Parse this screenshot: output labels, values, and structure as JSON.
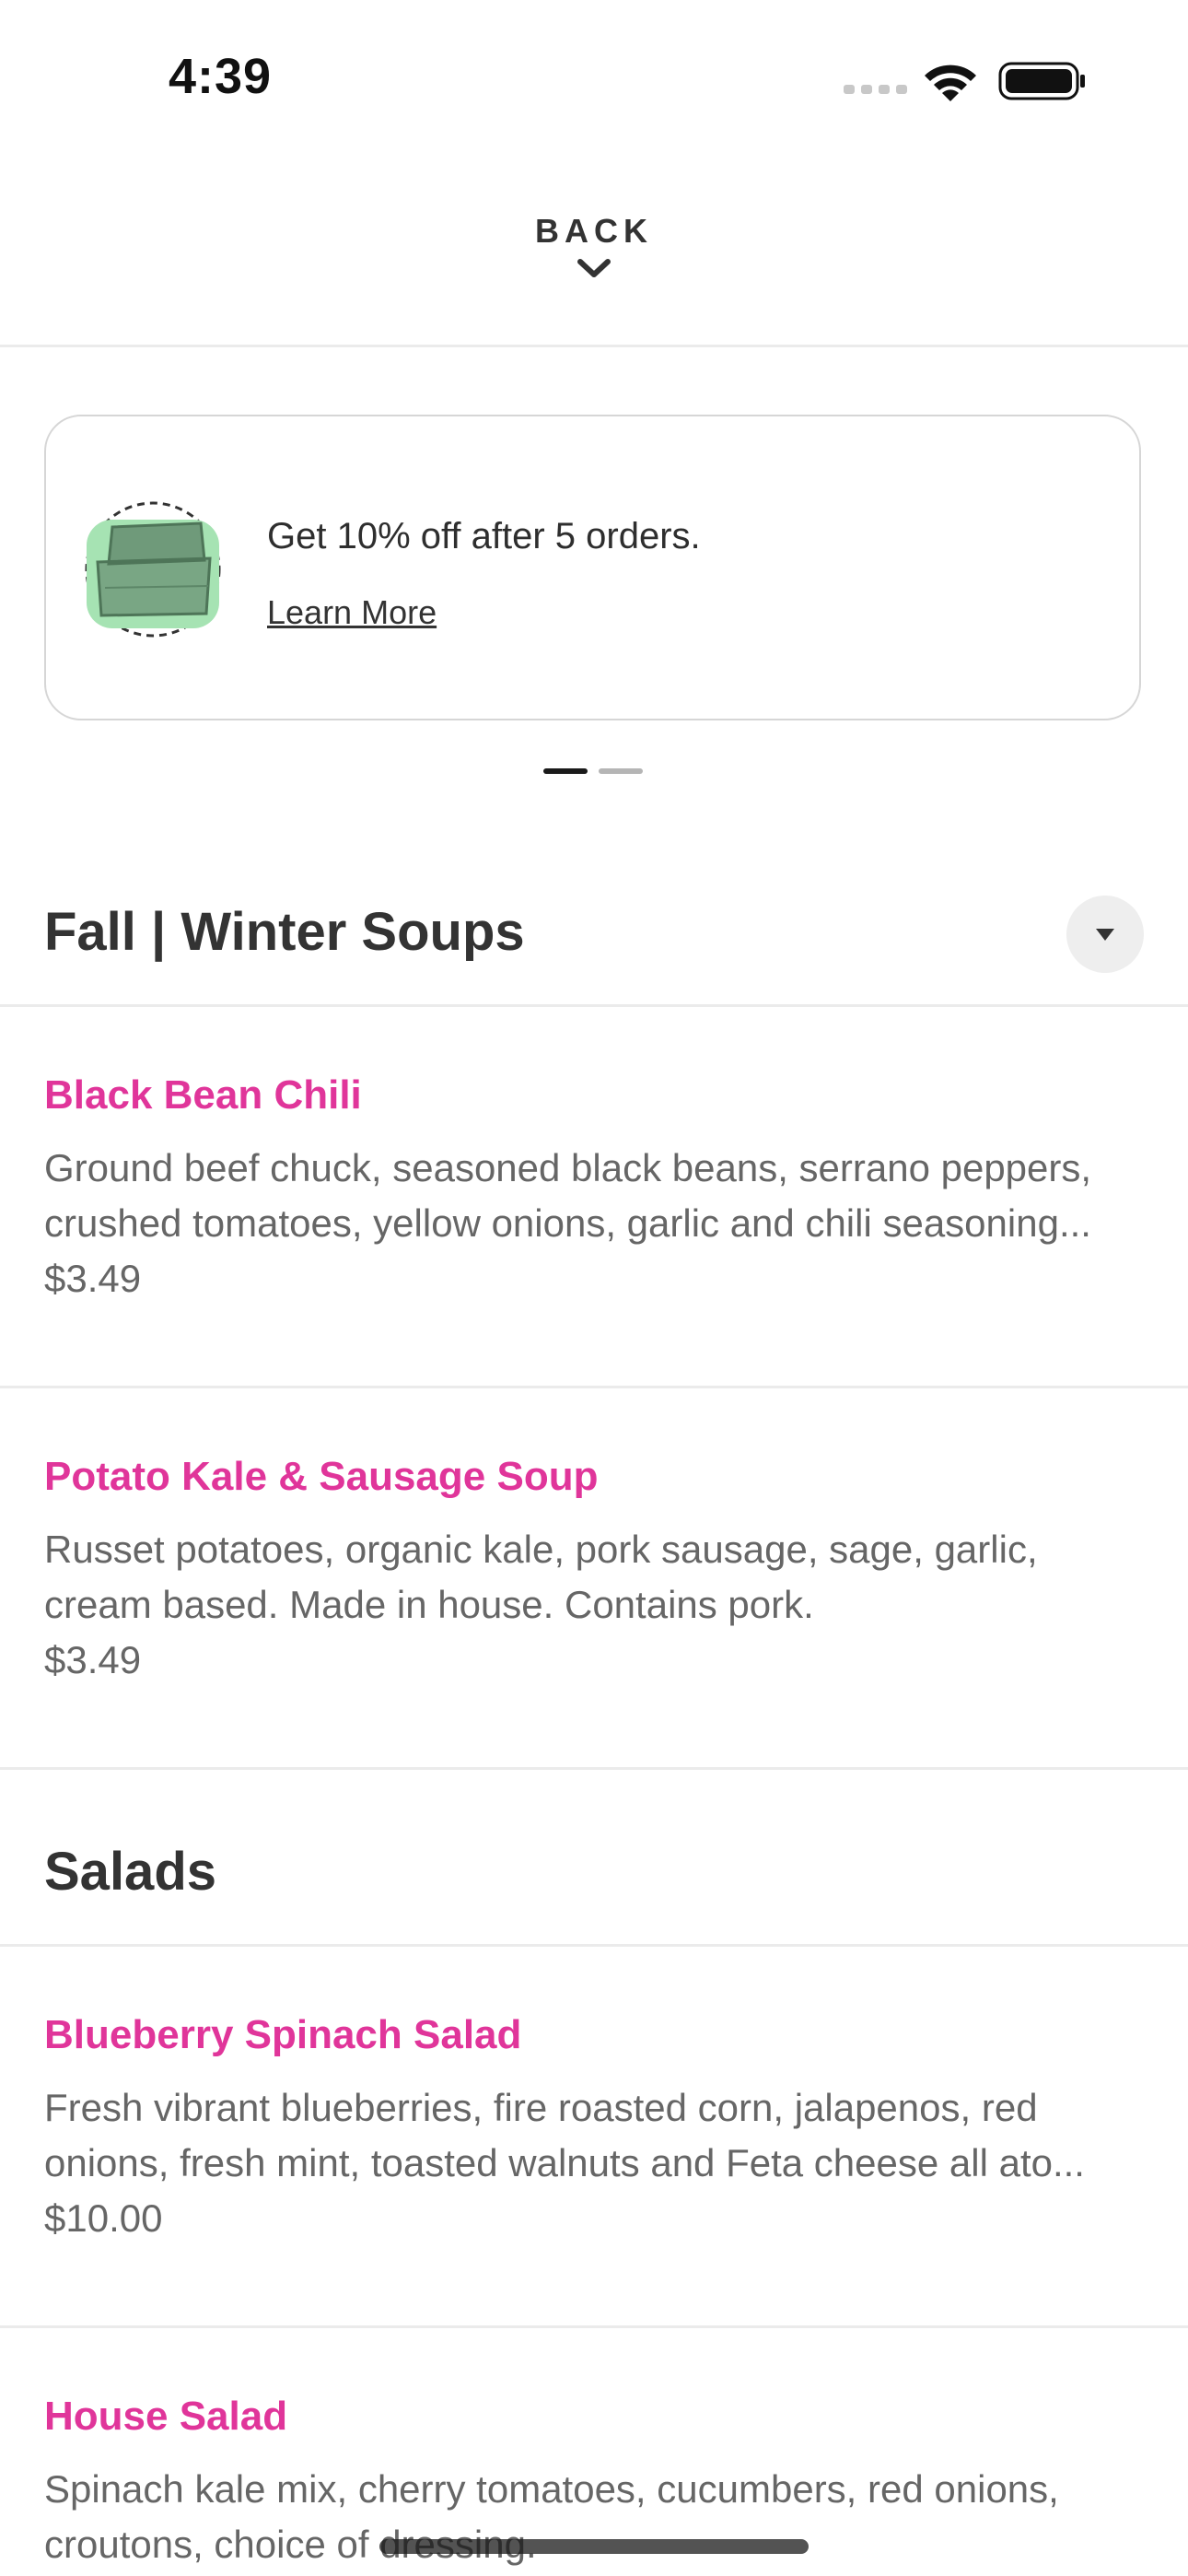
{
  "status_bar": {
    "time": "4:39"
  },
  "header": {
    "back_label": "BACK"
  },
  "promo": {
    "text": "Get 10% off after 5 orders.",
    "link": "Learn More",
    "pager": {
      "pages": 2,
      "active_index": 0
    }
  },
  "sections": [
    {
      "title": "Fall | Winter Soups",
      "items": [
        {
          "name": "Black Bean Chili",
          "description": "Ground beef chuck, seasoned black beans, serrano peppers, crushed tomatoes, yellow onions, garlic and chili seasoning...",
          "price": "$3.49"
        },
        {
          "name": "Potato Kale & Sausage Soup",
          "description": "Russet potatoes, organic kale, pork sausage, sage, garlic, cream based. Made in house. Contains pork.",
          "price": "$3.49"
        }
      ]
    },
    {
      "title": "Salads",
      "items": [
        {
          "name": "Blueberry Spinach Salad",
          "description": "Fresh vibrant blueberries, fire roasted corn, jalapenos, red onions, fresh mint, toasted walnuts and Feta cheese all ato...",
          "price": "$10.00"
        },
        {
          "name": "House Salad",
          "description": "Spinach kale mix, cherry tomatoes, cucumbers, red onions, croutons, choice of dressing."
        }
      ]
    }
  ],
  "colors": {
    "item_name": "#e0359a",
    "text_primary": "#333333",
    "text_secondary": "#666666",
    "promo_icon_green": "#a6e3b3"
  },
  "icons": [
    "signal-icon",
    "wifi-icon",
    "battery-icon",
    "chevron-down-icon",
    "container-stack-icon",
    "caret-down-icon"
  ]
}
